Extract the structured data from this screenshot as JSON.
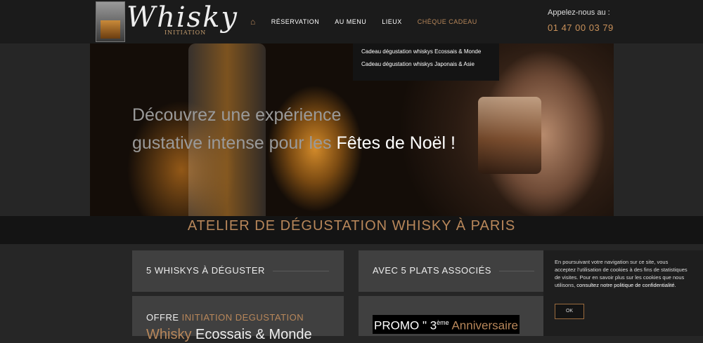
{
  "logo": {
    "word": "Whisky",
    "sub": "INITIATION"
  },
  "nav": {
    "home_icon": "home-icon",
    "items": [
      "RÉSERVATION",
      "AU MENU",
      "LIEUX",
      "CHÈQUE CADEAU"
    ],
    "active_index": 3
  },
  "phone": {
    "label": "Appelez-nous au :",
    "number": "01 47 00 03 79"
  },
  "dropdown": [
    "Cadeau dégustation whiskys Ecossais & Monde",
    "Cadeau dégustation whiskys Japonais & Asie"
  ],
  "hero": {
    "line1": "Découvrez une expérience",
    "line2_plain": "gustative intense pour les ",
    "line2_highlight": "Fêtes de Noël !"
  },
  "band": {
    "title": "ATELIER DE DÉGUSTATION WHISKY À PARIS"
  },
  "cards": {
    "c1": "5 WHISKYS À DÉGUSTER",
    "c2": "AVEC 5 PLATS ASSOCIÉS",
    "c3": {
      "prefix": "OFFRE ",
      "highlight": "INITIATION DEGUSTATION",
      "big_gold": "Whisky ",
      "big_white": "Ecossais & Monde"
    },
    "c4": {
      "promo": "PROMO \" 3",
      "sup": "ème",
      "anniv": " Anniversaire"
    }
  },
  "cookie": {
    "text": "En poursuivant votre navigation sur ce site, vous acceptez l'utilisation de cookies à des fins de statistiques de visites. Pour en savoir plus sur les cookies que nous utilisons,",
    "link": "consultez notre politique de confidentialité.",
    "ok": "OK"
  },
  "colors": {
    "accent": "#b8875a",
    "background": "#262626",
    "card": "#404040"
  }
}
